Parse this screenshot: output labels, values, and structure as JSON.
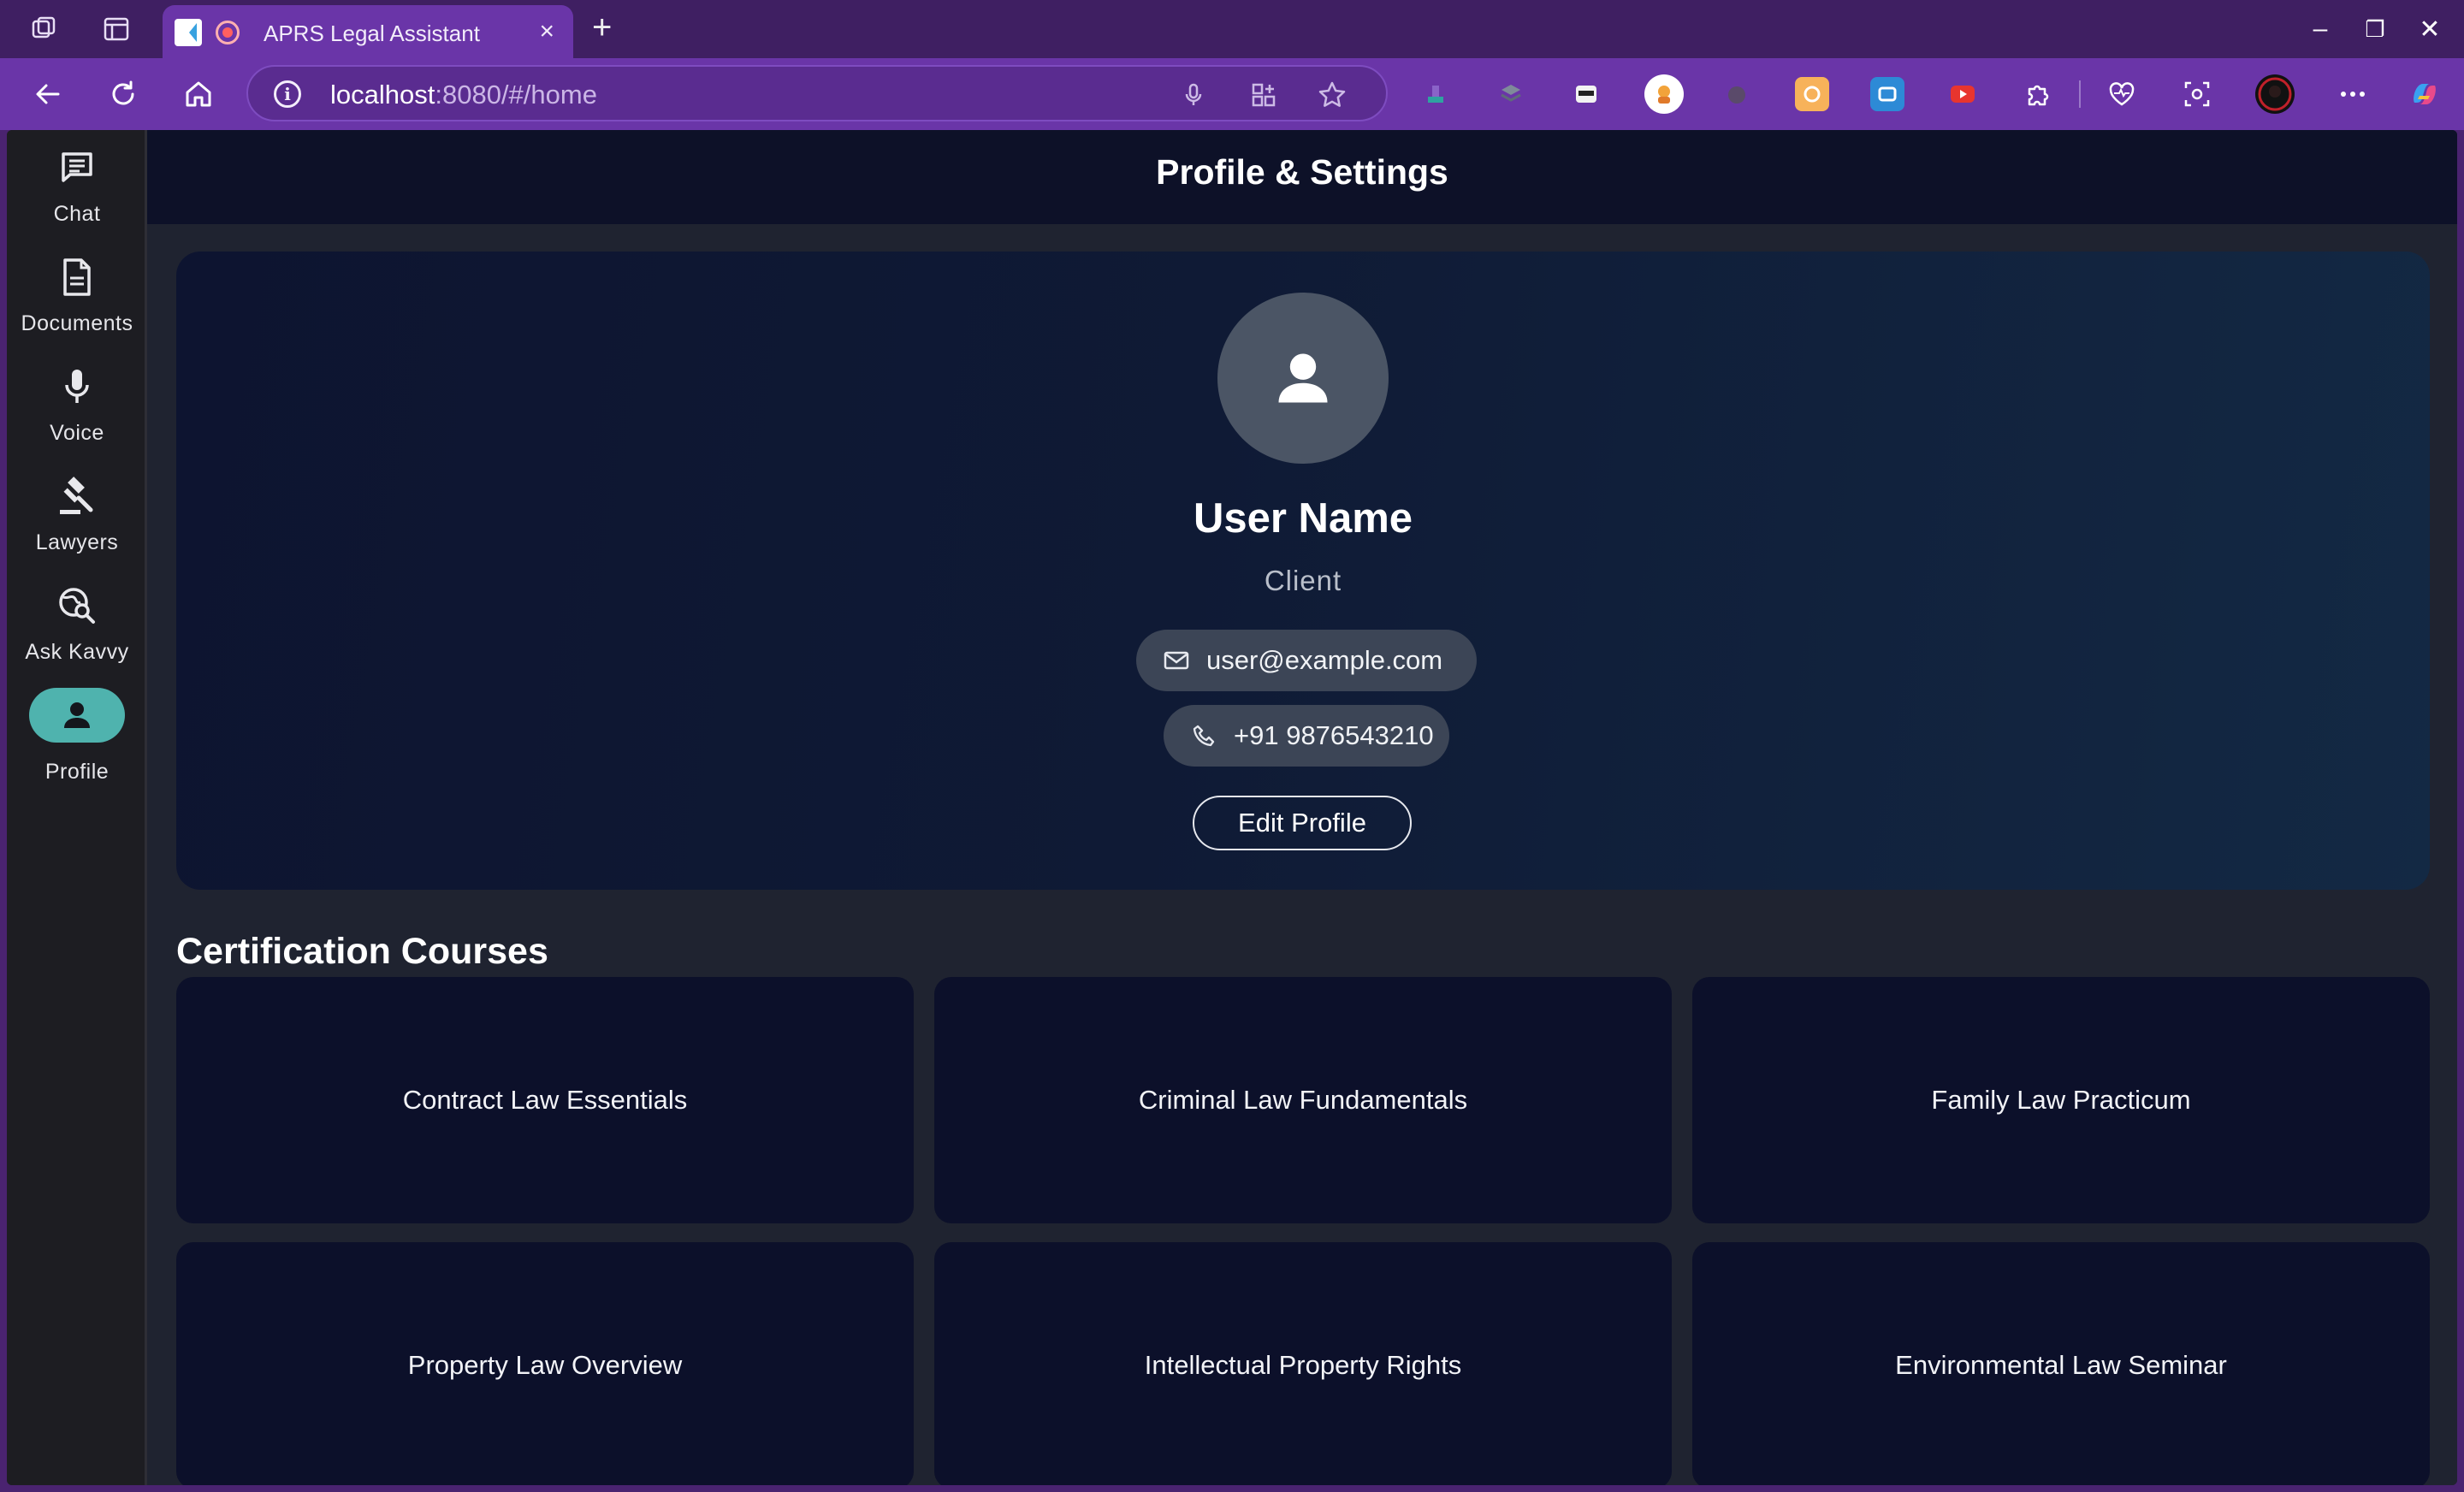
{
  "browser": {
    "tab_title": "APRS Legal Assistant",
    "tab_close": "×",
    "new_tab": "+",
    "url_host": "localhost",
    "url_rest": ":8080/#/home",
    "window_controls": {
      "minimize": "–",
      "restore": "❐",
      "close": "✕"
    }
  },
  "sidebar": {
    "items": [
      {
        "label": "Chat",
        "icon": "chat-icon"
      },
      {
        "label": "Documents",
        "icon": "document-icon"
      },
      {
        "label": "Voice",
        "icon": "microphone-icon"
      },
      {
        "label": "Lawyers",
        "icon": "gavel-icon"
      },
      {
        "label": "Ask Kavvy",
        "icon": "search-globe-icon"
      },
      {
        "label": "Profile",
        "icon": "person-icon",
        "active": true
      }
    ]
  },
  "appbar": {
    "title": "Profile & Settings"
  },
  "profile": {
    "name": "User Name",
    "role": "Client",
    "email": "user@example.com",
    "phone": "+91 9876543210",
    "edit_label": "Edit Profile"
  },
  "courses": {
    "title": "Certification Courses",
    "items": [
      "Contract Law Essentials",
      "Criminal Law Fundamentals",
      "Family Law Practicum",
      "Property Law Overview",
      "Intellectual Property Rights",
      "Environmental Law Seminar"
    ]
  },
  "colors": {
    "browser_frame": "#6a35a8",
    "sidebar_bg": "#1d1d22",
    "appbar_bg": "#0d1128",
    "active_pill": "#4fb3ae",
    "chip_bg": "#3c4556",
    "course_bg": "#0c102a"
  }
}
